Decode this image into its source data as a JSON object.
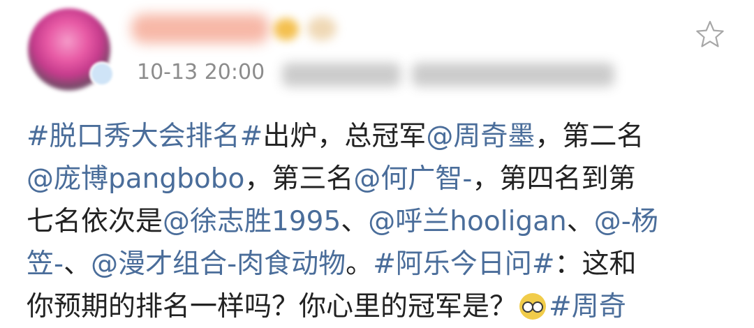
{
  "post": {
    "timestamp": "10-13 20:00",
    "source_blurred": "来自 微博",
    "content": {
      "lines": [
        [
          {
            "text": "#脱口秀大会排名#",
            "link": true
          },
          {
            "text": "出炉，总冠军",
            "link": false
          },
          {
            "text": "@周奇墨",
            "link": true
          },
          {
            "text": "，第二名",
            "link": false
          }
        ],
        [
          {
            "text": "@庞博pangbobo",
            "link": true
          },
          {
            "text": "，第三名",
            "link": false
          },
          {
            "text": "@何广智-",
            "link": true
          },
          {
            "text": "，第四名到第",
            "link": false
          }
        ],
        [
          {
            "text": "七名依次是",
            "link": false
          },
          {
            "text": "@徐志胜1995",
            "link": true
          },
          {
            "text": "、",
            "link": false
          },
          {
            "text": "@呼兰hooligan",
            "link": true
          },
          {
            "text": "、",
            "link": false
          },
          {
            "text": "@-杨",
            "link": true
          }
        ],
        [
          {
            "text": "笠-",
            "link": true
          },
          {
            "text": "、",
            "link": false
          },
          {
            "text": "@漫才组合-肉食动物",
            "link": true
          },
          {
            "text": "。",
            "link": false
          },
          {
            "text": "#阿乐今日问#",
            "link": true
          },
          {
            "text": "：这和",
            "link": false
          }
        ],
        [
          {
            "text": "你预期的排名一样吗？你心里的冠军是？",
            "link": false
          },
          {
            "emoji": "nerd-glasses-emoji"
          },
          {
            "text": "#周奇",
            "link": true
          }
        ]
      ]
    }
  },
  "colors": {
    "link": "#4a6d9a",
    "text": "#222222",
    "meta": "#8c8c8c",
    "star_outline": "#a7a7a7"
  }
}
